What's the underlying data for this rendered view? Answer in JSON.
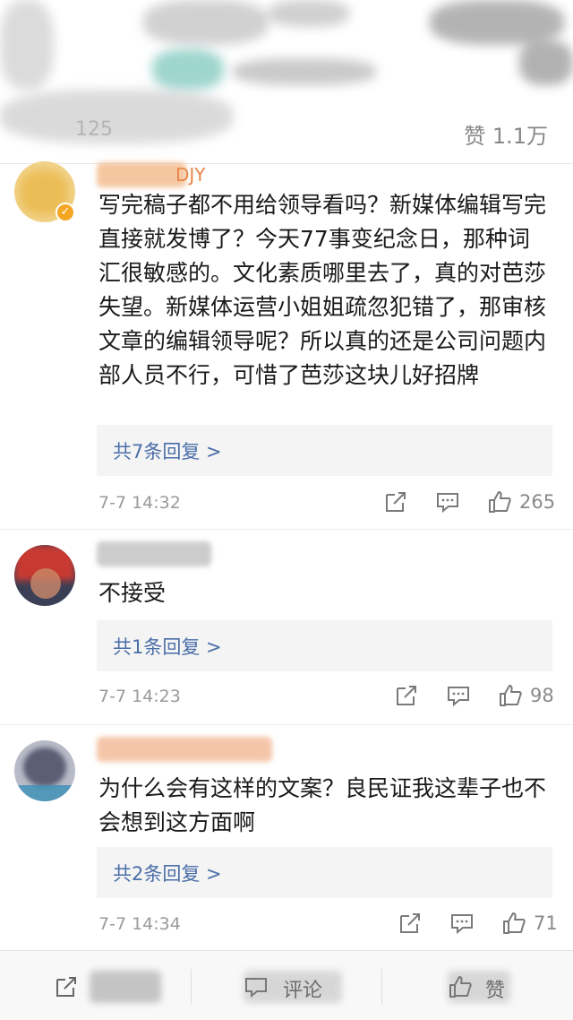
{
  "stats": {
    "partial_count_left": "125",
    "like_label": "赞",
    "like_count": "1.1万"
  },
  "comments": [
    {
      "username": "DJY",
      "text": "写完稿子都不用给领导看吗？新媒体编辑写完直接就发博了？今天77事变纪念日，那种词汇很敏感的。文化素质哪里去了，真的对芭莎失望。新媒体运营小姐姐疏忽犯错了，那审核文章的编辑领导呢？所以真的还是公司问题内部人员不行，可惜了芭莎这块儿好招牌",
      "reply_label": "共7条回复 >",
      "time": "7-7 14:32",
      "likes": "265"
    },
    {
      "username": "",
      "text": "不接受",
      "reply_label": "共1条回复 >",
      "time": "7-7 14:23",
      "likes": "98"
    },
    {
      "username": "",
      "text": "为什么会有这样的文案？良民证我这辈子也不会想到这方面啊",
      "reply_label": "共2条回复 >",
      "time": "7-7 14:34",
      "likes": "71"
    }
  ],
  "bottom_bar": {
    "comment_label": "评论",
    "like_label": "赞"
  },
  "colors": {
    "reply_link": "#4a6ea8",
    "username": "#e8874a",
    "meta_gray": "#9a9a9a"
  },
  "icons": [
    "share-icon",
    "comment-icon",
    "thumbs-up-icon",
    "verified-badge-icon"
  ]
}
